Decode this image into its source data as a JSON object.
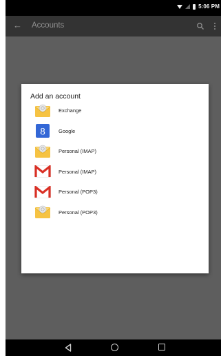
{
  "status_bar": {
    "time": "5:06 PM"
  },
  "app_bar": {
    "title": "Accounts"
  },
  "dialog": {
    "title": "Add an account",
    "items": [
      {
        "label": "Exchange",
        "icon": "envelope-icon"
      },
      {
        "label": "Google",
        "icon": "google-icon"
      },
      {
        "label": "Personal (IMAP)",
        "icon": "envelope-icon"
      },
      {
        "label": "Personal (IMAP)",
        "icon": "gmail-icon"
      },
      {
        "label": "Personal (POP3)",
        "icon": "gmail-icon"
      },
      {
        "label": "Personal (POP3)",
        "icon": "envelope-icon"
      }
    ]
  },
  "colors": {
    "status_bar": "#000000",
    "app_bar": "#333333",
    "scrim": "#5e5e5e",
    "dialog": "#ffffff",
    "gmail_red": "#d93025",
    "google_blue": "#3367d6",
    "envelope_yellow": "#f6c343"
  }
}
